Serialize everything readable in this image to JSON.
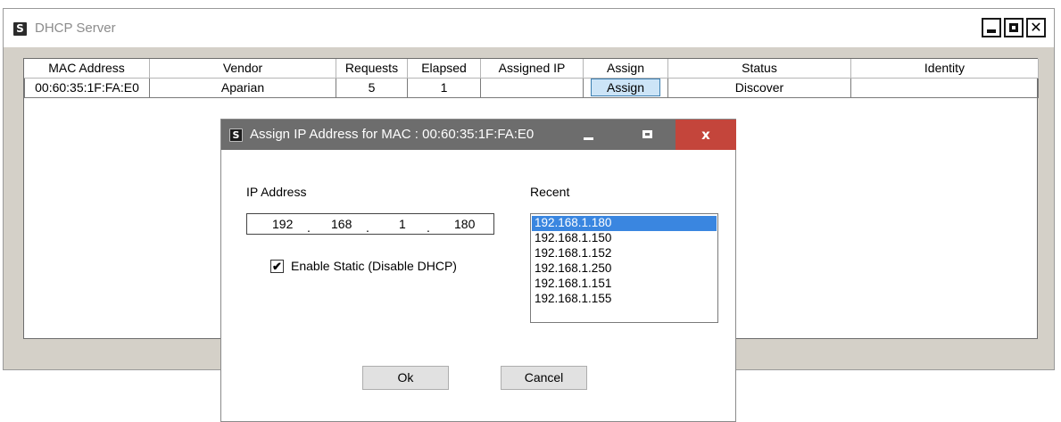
{
  "main_window": {
    "title": "DHCP Server",
    "icon_letter": "S",
    "controls": {
      "minimize": "minimize",
      "maximize": "maximize",
      "close": "✕"
    }
  },
  "grid": {
    "columns": [
      "MAC Address",
      "Vendor",
      "Requests",
      "Elapsed",
      "Assigned IP",
      "Assign",
      "Status",
      "Identity"
    ],
    "rows": [
      {
        "mac": "00:60:35:1F:FA:E0",
        "vendor": "Aparian",
        "requests": "5",
        "elapsed": "1",
        "assigned_ip": "",
        "assign_label": "Assign",
        "status": "Discover",
        "identity": ""
      }
    ]
  },
  "dialog": {
    "icon_letter": "S",
    "title": "Assign IP Address for MAC : 00:60:35:1F:FA:E0",
    "close_label": "x",
    "ip_label": "IP Address",
    "ip_octets": [
      "192",
      "168",
      "1",
      "180"
    ],
    "ip_separator": ".",
    "static_checkbox": {
      "checked": true,
      "mark": "✔",
      "label": "Enable Static (Disable DHCP)"
    },
    "recent_label": "Recent",
    "recent_items": [
      "192.168.1.180",
      "192.168.1.150",
      "192.168.1.152",
      "192.168.1.250",
      "192.168.1.151",
      "192.168.1.155"
    ],
    "recent_selected_index": 0,
    "ok_label": "Ok",
    "cancel_label": "Cancel"
  },
  "colors": {
    "dialog_titlebar": "#6d6d6d",
    "dialog_close": "#c4453b",
    "selection": "#3a86e0",
    "assign_button": "#cce4f7"
  }
}
